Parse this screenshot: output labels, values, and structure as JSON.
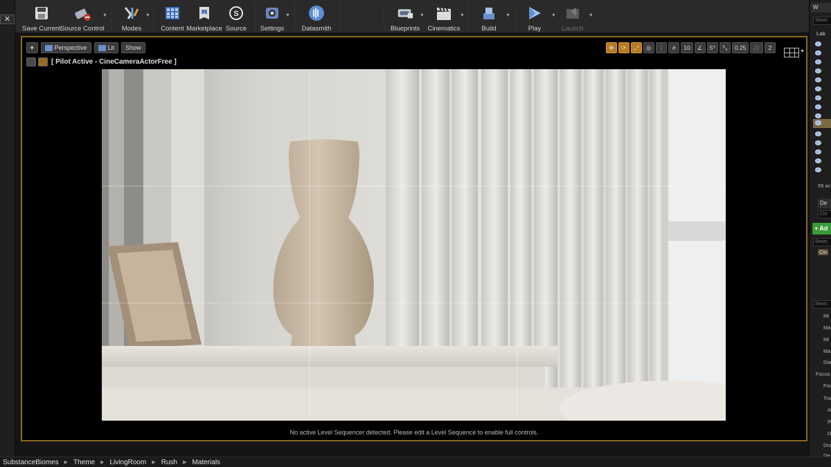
{
  "left_panel": {
    "close_glyph": "✕"
  },
  "toolbar": {
    "buttons": [
      {
        "label": "Save Current",
        "icon": "floppy-disk-icon"
      },
      {
        "label": "Source Control",
        "icon": "source-control-icon"
      },
      {
        "label": "Modes",
        "icon": "modes-icon"
      },
      {
        "label": "Content",
        "icon": "content-browser-icon"
      },
      {
        "label": "Marketplace",
        "icon": "marketplace-icon"
      },
      {
        "label": "Source",
        "icon": "unreal-source-icon"
      },
      {
        "label": "Settings",
        "icon": "settings-gear-icon"
      },
      {
        "label": "Datasmith",
        "icon": "datasmith-icon"
      },
      {
        "label": "Blueprints",
        "icon": "blueprints-icon"
      },
      {
        "label": "Cinematics",
        "icon": "clapperboard-icon"
      },
      {
        "label": "Build",
        "icon": "build-icon"
      },
      {
        "label": "Play",
        "icon": "play-icon"
      },
      {
        "label": "Launch",
        "icon": "launch-icon",
        "disabled": true
      }
    ]
  },
  "viewport": {
    "view_mode": "Perspective",
    "lighting_mode": "Lit",
    "show_label": "Show",
    "pilot_text": "[ Pilot Active - CineCameraActorFree ]",
    "grid_snap": "10",
    "rotation_snap": "5°",
    "scale_snap": "0.25",
    "camera_speed": "2",
    "message": "No active Level Sequencer detected. Please edit a Level Sequence to enable full controls.",
    "accent_color": "#8a6a1e"
  },
  "right_panel": {
    "world_tab": "W",
    "search_placeholder": "Searc",
    "label_column": "Lab",
    "actor_count": "59 ac",
    "details_tab": "De",
    "details_name": "Cin",
    "add_button": "+ Ad",
    "component_root": "Cin",
    "details_search": "Searc",
    "properties": [
      "Mi",
      "Ma",
      "Mi",
      "Ma",
      "Dia",
      "Focus",
      "Foo",
      "Tra",
      "A",
      "R",
      "D",
      "Dra",
      "De"
    ]
  },
  "breadcrumbs": [
    "SubstanceBiomes",
    "Theme",
    "LivingRoom",
    "Rush",
    "Materials"
  ],
  "scene_caption_colors": {
    "wall": "#d9d7d1",
    "vase": "#c8b8a2",
    "window": "#eef0ef"
  }
}
